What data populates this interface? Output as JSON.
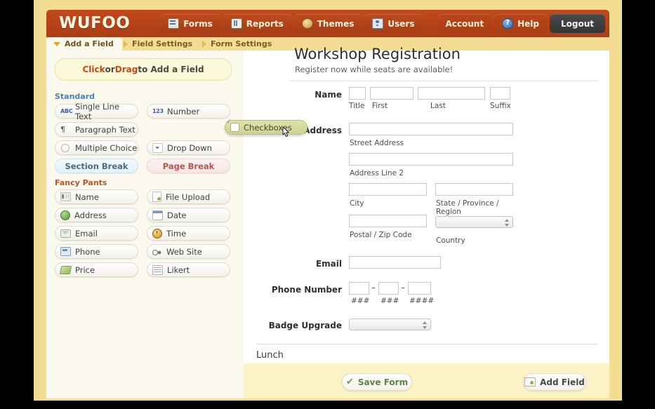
{
  "brand": {
    "logo": "WUFOO",
    "header_color": "#b44318",
    "page_bg": "#f2dd93"
  },
  "topnav": {
    "items": [
      {
        "label": "Forms",
        "icon": "forms-icon"
      },
      {
        "label": "Reports",
        "icon": "reports-icon"
      },
      {
        "label": "Themes",
        "icon": "themes-icon"
      },
      {
        "label": "Users",
        "icon": "users-icon"
      }
    ],
    "account": {
      "label": "Account"
    },
    "help": {
      "label": "Help",
      "icon": "help-icon"
    },
    "logout": {
      "label": "Logout"
    }
  },
  "tabs": [
    {
      "label": "Add a Field",
      "active": true
    },
    {
      "label": "Field Settings",
      "active": false
    },
    {
      "label": "Form Settings",
      "active": false
    }
  ],
  "sidebar": {
    "hint": {
      "click": "Click",
      "or": " or ",
      "drag": "Drag",
      "tail": " to Add a Field"
    },
    "standard_heading": "Standard",
    "standard": [
      {
        "label": "Single Line Text",
        "icon": "abc-icon",
        "col": 0,
        "row": 0
      },
      {
        "label": "Number",
        "icon": "123-icon",
        "col": 1,
        "row": 0
      },
      {
        "label": "Paragraph Text",
        "icon": "pilcrow-icon",
        "col": 0,
        "row": 1
      },
      {
        "label": "Checkboxes",
        "icon": "checkbox-icon",
        "col": 1,
        "row": 1
      },
      {
        "label": "Multiple Choice",
        "icon": "radio-icon",
        "col": 0,
        "row": 2
      },
      {
        "label": "Drop Down",
        "icon": "dropdown-icon",
        "col": 1,
        "row": 2
      },
      {
        "label": "Section Break",
        "icon": "none",
        "col": 0,
        "row": 3
      },
      {
        "label": "Page Break",
        "icon": "none",
        "col": 1,
        "row": 3
      }
    ],
    "fancy_heading": "Fancy Pants",
    "fancy": [
      {
        "label": "Name",
        "icon": "name-icon"
      },
      {
        "label": "File Upload",
        "icon": "file-upload-icon"
      },
      {
        "label": "Address",
        "icon": "globe-icon"
      },
      {
        "label": "Date",
        "icon": "calendar-icon"
      },
      {
        "label": "Email",
        "icon": "envelope-icon"
      },
      {
        "label": "Time",
        "icon": "clock-icon"
      },
      {
        "label": "Phone",
        "icon": "phone-icon"
      },
      {
        "label": "Web Site",
        "icon": "link-icon"
      },
      {
        "label": "Price",
        "icon": "money-icon"
      },
      {
        "label": "Likert",
        "icon": "likert-icon"
      }
    ],
    "dragging": {
      "label": "Checkboxes",
      "icon": "checkbox-icon"
    }
  },
  "form": {
    "title": "Workshop Registration",
    "subtitle": "Register now while seats are available!",
    "fields": {
      "name": {
        "label": "Name",
        "sublabels": [
          "Title",
          "First",
          "Last",
          "Suffix"
        ],
        "values": [
          "",
          "",
          "",
          ""
        ]
      },
      "address": {
        "label": "Address",
        "street": {
          "sublabel": "Street Address",
          "value": ""
        },
        "line2": {
          "sublabel": "Address Line 2",
          "value": ""
        },
        "city": {
          "sublabel": "City",
          "value": ""
        },
        "state": {
          "sublabel": "State / Province / Region",
          "value": ""
        },
        "postal": {
          "sublabel": "Postal / Zip Code",
          "value": ""
        },
        "country": {
          "sublabel": "Country",
          "value": ""
        }
      },
      "email": {
        "label": "Email",
        "value": ""
      },
      "phone": {
        "label": "Phone Number",
        "values": [
          "",
          "",
          ""
        ],
        "sublabels": [
          "###",
          "###",
          "####"
        ],
        "separator": "–"
      },
      "badge": {
        "label": "Badge Upgrade",
        "value": ""
      }
    },
    "section_break": {
      "label": "Lunch"
    }
  },
  "footer": {
    "save": {
      "label": "Save Form",
      "icon": "check-icon"
    },
    "add": {
      "label": "Add Field",
      "icon": "add-field-icon"
    }
  }
}
